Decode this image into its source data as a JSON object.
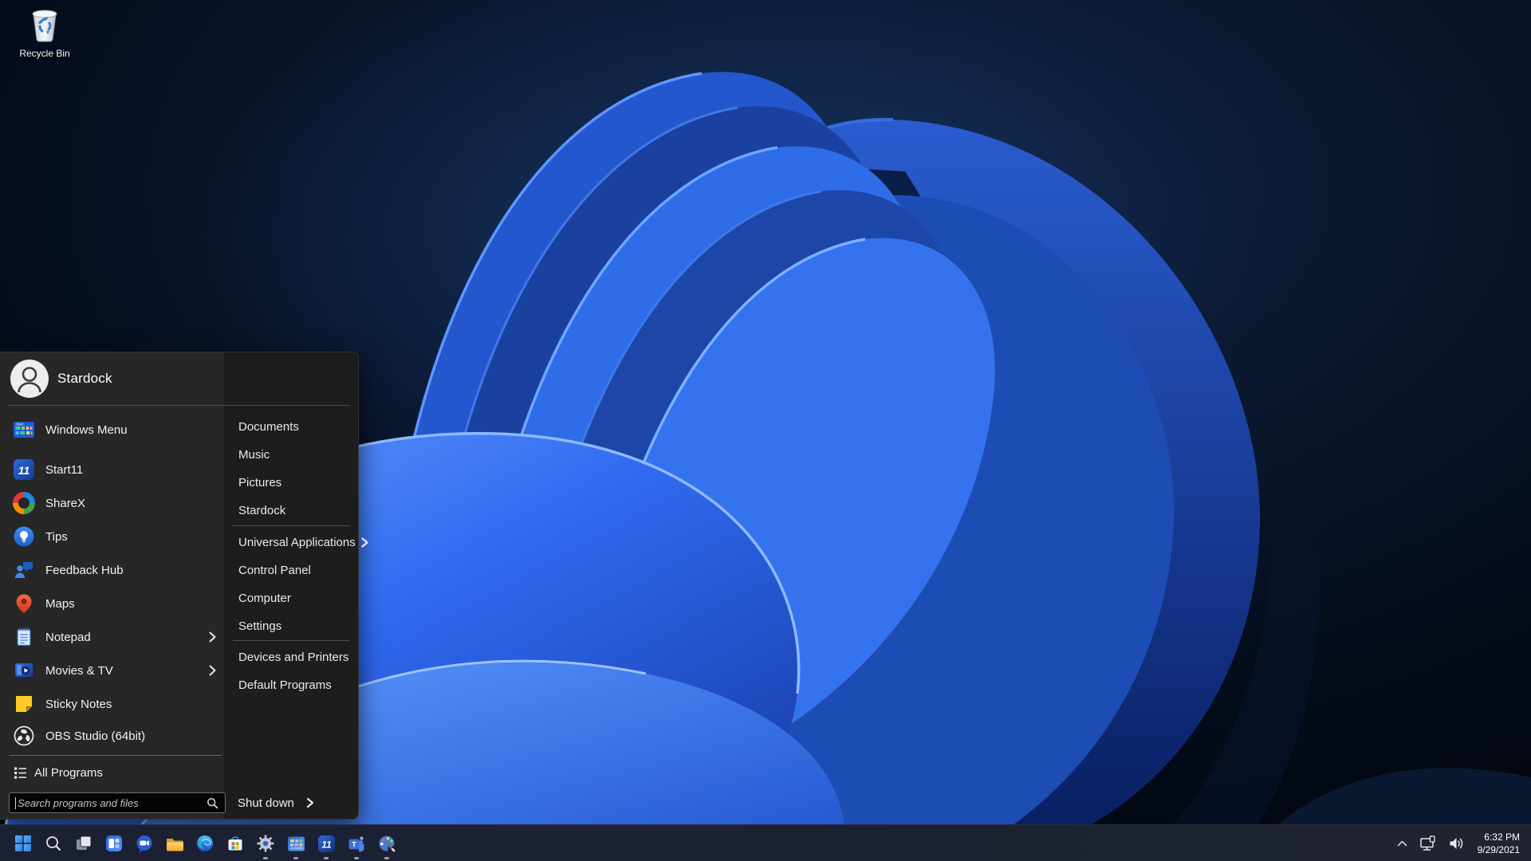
{
  "desktop": {
    "icons": [
      {
        "label": "Recycle Bin",
        "icon": "recycle-bin"
      }
    ]
  },
  "start_menu": {
    "user_name": "Stardock",
    "left_items": [
      {
        "label": "Windows Menu",
        "icon": "windows-menu",
        "has_submenu": false
      },
      {
        "label": "Start11",
        "icon": "start11",
        "has_submenu": false
      },
      {
        "label": "ShareX",
        "icon": "sharex",
        "has_submenu": false
      },
      {
        "label": "Tips",
        "icon": "tips",
        "has_submenu": false
      },
      {
        "label": "Feedback Hub",
        "icon": "feedback-hub",
        "has_submenu": false
      },
      {
        "label": "Maps",
        "icon": "maps",
        "has_submenu": false
      },
      {
        "label": "Notepad",
        "icon": "notepad",
        "has_submenu": true
      },
      {
        "label": "Movies & TV",
        "icon": "movies-tv",
        "has_submenu": true
      },
      {
        "label": "Sticky Notes",
        "icon": "sticky-notes",
        "has_submenu": false
      },
      {
        "label": "OBS Studio (64bit)",
        "icon": "obs-studio",
        "has_submenu": false
      }
    ],
    "all_programs_label": "All Programs",
    "search_placeholder": "Search programs and files",
    "right_items": [
      {
        "label": "Documents",
        "has_submenu": false
      },
      {
        "label": "Music",
        "has_submenu": false
      },
      {
        "label": "Pictures",
        "has_submenu": false
      },
      {
        "label": "Stardock",
        "has_submenu": false
      },
      {
        "label": "Universal Applications",
        "has_submenu": true
      },
      {
        "label": "Control Panel",
        "has_submenu": false
      },
      {
        "label": "Computer",
        "has_submenu": false
      },
      {
        "label": "Settings",
        "has_submenu": false
      },
      {
        "label": "Devices and Printers",
        "has_submenu": false
      },
      {
        "label": "Default Programs",
        "has_submenu": false
      }
    ],
    "shutdown_label": "Shut down"
  },
  "taskbar": {
    "items": [
      {
        "name": "start",
        "running": false
      },
      {
        "name": "search",
        "running": false
      },
      {
        "name": "task-view",
        "running": false
      },
      {
        "name": "widgets",
        "running": false
      },
      {
        "name": "chat",
        "running": false
      },
      {
        "name": "file-explorer",
        "running": false
      },
      {
        "name": "edge",
        "running": false
      },
      {
        "name": "store",
        "running": false
      },
      {
        "name": "settings",
        "running": true
      },
      {
        "name": "windows-menu",
        "running": true
      },
      {
        "name": "start11",
        "running": true
      },
      {
        "name": "teams",
        "running": true
      },
      {
        "name": "paint",
        "running": true
      }
    ],
    "tray": {
      "icons": [
        "tray-expand",
        "network",
        "volume"
      ],
      "time": "6:32 PM",
      "date": "9/29/2021"
    }
  },
  "colors": {
    "accent_blue": "#2e6cf2",
    "menu_bg": "#1d1d1d",
    "menu_left_bg": "#272727",
    "taskbar_bg": "#1c2232",
    "wallpaper_dark": "#060d1c"
  }
}
